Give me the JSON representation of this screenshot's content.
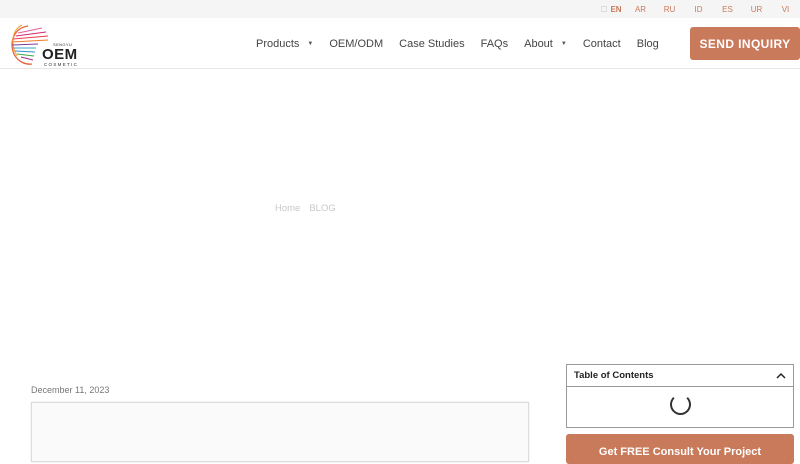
{
  "languages": [
    {
      "code": "EN",
      "active": true
    },
    {
      "code": "AR",
      "active": false
    },
    {
      "code": "RU",
      "active": false
    },
    {
      "code": "ID",
      "active": false
    },
    {
      "code": "ES",
      "active": false
    },
    {
      "code": "UR",
      "active": false
    },
    {
      "code": "VI",
      "active": false
    }
  ],
  "logo": {
    "main": "OEM",
    "sub": "COSMETIC",
    "tag": "SENGYU"
  },
  "nav": {
    "items": [
      {
        "label": "Products",
        "dropdown": true
      },
      {
        "label": "OEM/ODM",
        "dropdown": false
      },
      {
        "label": "Case Studies",
        "dropdown": false
      },
      {
        "label": "FAQs",
        "dropdown": false
      },
      {
        "label": "About",
        "dropdown": true
      },
      {
        "label": "Contact",
        "dropdown": false
      },
      {
        "label": "Blog",
        "dropdown": false
      }
    ]
  },
  "header": {
    "inquiry_label": "SEND INQUIRY"
  },
  "breadcrumb": {
    "home": "Home",
    "current": "BLOG"
  },
  "post": {
    "date": "December 11, 2023"
  },
  "toc": {
    "title": "Table of Contents",
    "toggle_icon": "chevron-up-icon"
  },
  "consult": {
    "label": "Get FREE Consult Your Project"
  },
  "colors": {
    "accent": "#c97a5a",
    "topbar": "#f5f5f5"
  }
}
